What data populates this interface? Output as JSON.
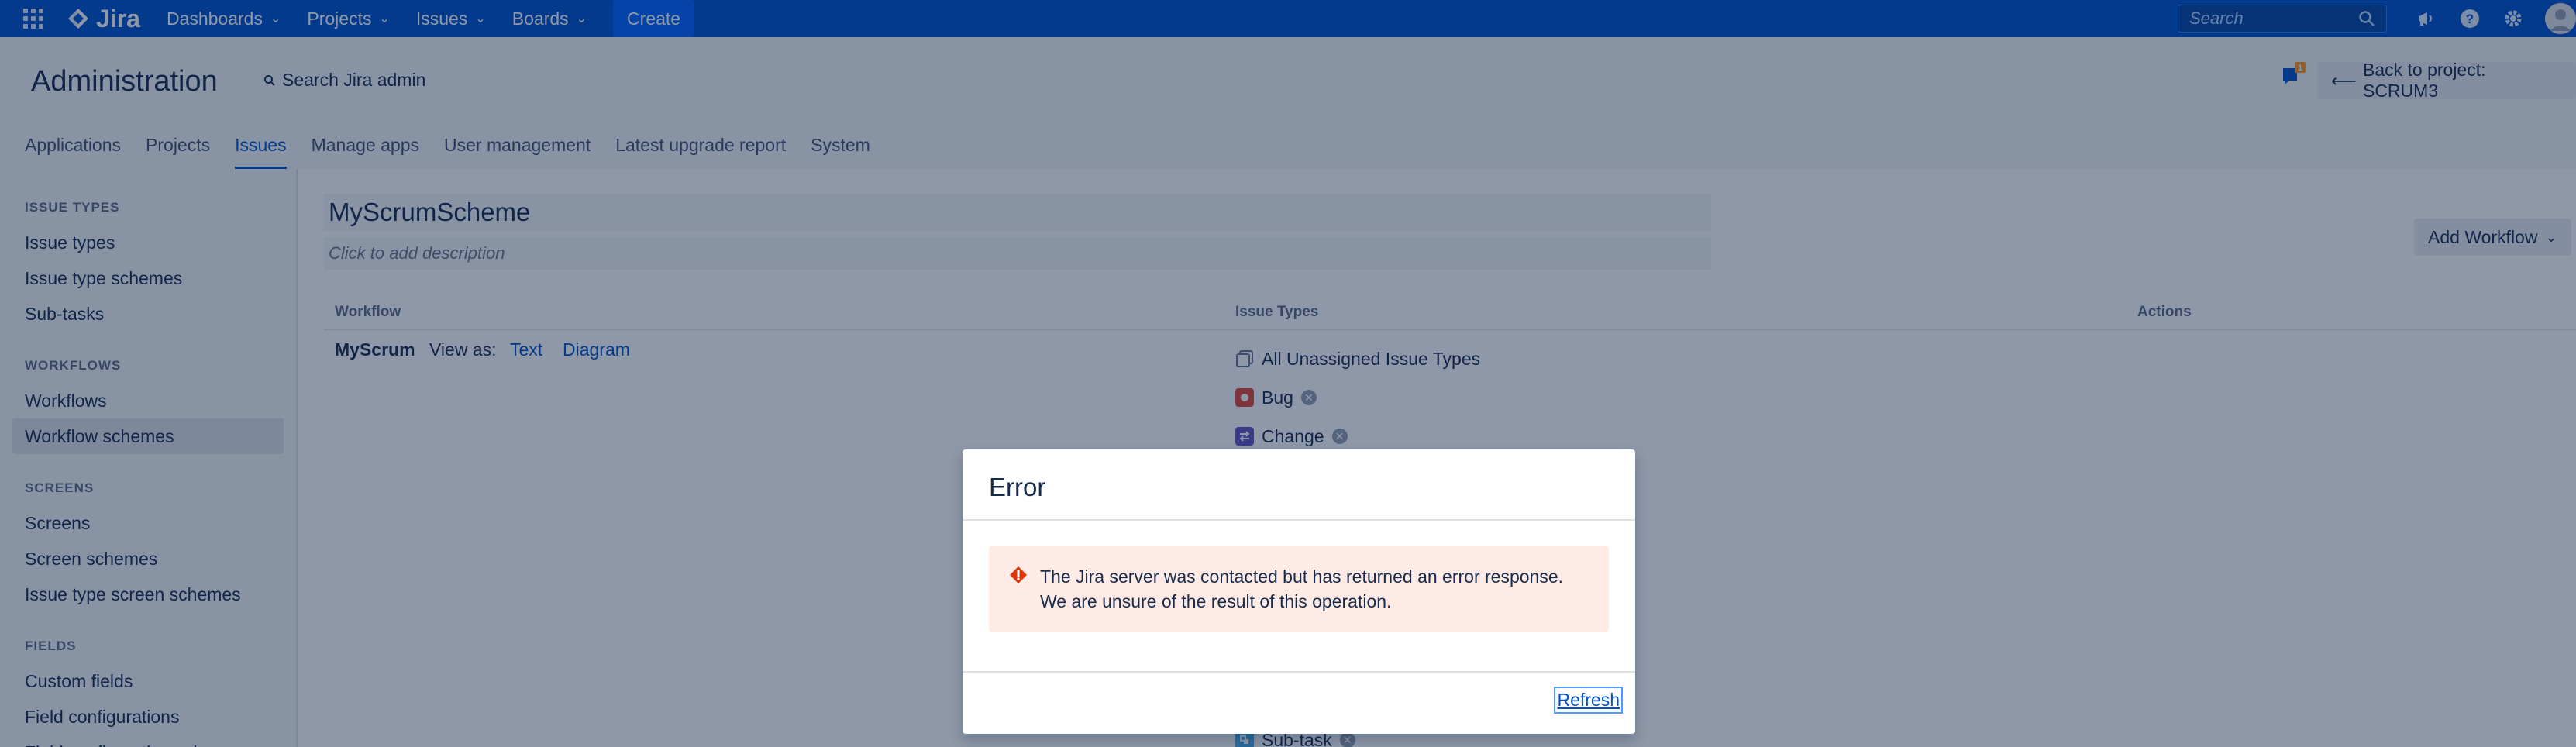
{
  "topnav": {
    "logo_text": "Jira",
    "items": [
      {
        "label": "Dashboards"
      },
      {
        "label": "Projects"
      },
      {
        "label": "Issues"
      },
      {
        "label": "Boards"
      }
    ],
    "create_label": "Create",
    "search_placeholder": "Search",
    "icons": [
      "megaphone-icon",
      "help-icon",
      "settings-icon",
      "avatar"
    ]
  },
  "admin": {
    "title": "Administration",
    "search_label": "Search Jira admin",
    "back_label": "Back to project: SCRUM3",
    "notification_count": "1",
    "tabs": [
      {
        "label": "Applications"
      },
      {
        "label": "Projects"
      },
      {
        "label": "Issues"
      },
      {
        "label": "Manage apps"
      },
      {
        "label": "User management"
      },
      {
        "label": "Latest upgrade report"
      },
      {
        "label": "System"
      }
    ],
    "active_tab": "Issues"
  },
  "sidebar": {
    "groups": [
      {
        "heading": "ISSUE TYPES",
        "items": [
          "Issue types",
          "Issue type schemes",
          "Sub-tasks"
        ]
      },
      {
        "heading": "WORKFLOWS",
        "items": [
          "Workflows",
          "Workflow schemes"
        ]
      },
      {
        "heading": "SCREENS",
        "items": [
          "Screens",
          "Screen schemes",
          "Issue type screen schemes"
        ]
      },
      {
        "heading": "FIELDS",
        "items": [
          "Custom fields",
          "Field configurations",
          "Field configuration schemes"
        ]
      }
    ],
    "selected": "Workflow schemes"
  },
  "main": {
    "scheme_name": "MyScrumScheme",
    "description_placeholder": "Click to add description",
    "add_workflow_label": "Add Workflow",
    "table": {
      "headers": {
        "workflow": "Workflow",
        "issue_types": "Issue Types",
        "actions": "Actions"
      },
      "row": {
        "workflow_name": "MyScrum",
        "view_as": "View as:",
        "text_link": "Text",
        "diagram_link": "Diagram",
        "issue_types": [
          {
            "label": "All Unassigned Issue Types",
            "icon": "all-types-icon",
            "removable": false
          },
          {
            "label": "Bug",
            "icon": "bug-icon",
            "removable": true
          },
          {
            "label": "Change",
            "icon": "change-icon",
            "removable": true
          },
          {
            "label": "Sub-task",
            "icon": "subtask-icon",
            "removable": true
          }
        ]
      }
    }
  },
  "dialog": {
    "title": "Error",
    "message_line1": "The Jira server was contacted but has returned an error response.",
    "message_line2": "We are unsure of the result of this operation.",
    "refresh_label": "Refresh"
  },
  "colors": {
    "nav_blue": "#0052cc",
    "error_bg": "#ffebe6",
    "error_icon": "#de350b",
    "bug_red": "#e5493a",
    "change_purple": "#6554c0"
  }
}
